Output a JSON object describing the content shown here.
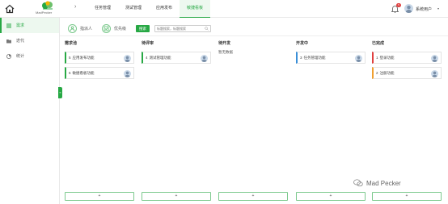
{
  "header": {
    "logo_text": "MadPecker",
    "nav": [
      "任务管理",
      "测试管理",
      "应用发布",
      "敏捷看板"
    ],
    "active_nav": 3,
    "notification_count": "5",
    "user_name": "系统用户"
  },
  "sidebar": {
    "items": [
      {
        "label": "需求",
        "icon": "list-icon"
      },
      {
        "label": "迭代",
        "icon": "folder-icon"
      },
      {
        "label": "统计",
        "icon": "chart-icon"
      }
    ],
    "active_index": 0,
    "toggle_label": "«"
  },
  "toolbar": {
    "assignee_label": "指派人",
    "priority_label": "优先级",
    "search_button": "搜索",
    "search_placeholder": "标题搜索，标题搜索"
  },
  "board": {
    "columns": [
      {
        "title": "需求池",
        "cards": [
          {
            "number": "5",
            "title": "应用发布功能",
            "accent": "#27a844"
          },
          {
            "number": "6",
            "title": "敏捷看板功能",
            "accent": "#27a844"
          }
        ],
        "empty_text": "",
        "add_label": "+"
      },
      {
        "title": "待评审",
        "cards": [
          {
            "number": "4",
            "title": "测试管理功能",
            "accent": "#27a844"
          }
        ],
        "empty_text": "",
        "add_label": "+"
      },
      {
        "title": "待开发",
        "cards": [],
        "empty_text": "暂无数据",
        "add_label": "+"
      },
      {
        "title": "开发中",
        "cards": [
          {
            "number": "3",
            "title": "任务管理功能",
            "accent": "#3a8fd8"
          }
        ],
        "empty_text": "",
        "add_label": "+"
      },
      {
        "title": "已完成",
        "cards": [
          {
            "number": "1",
            "title": "登录功能",
            "accent": "#e04040"
          },
          {
            "number": "2",
            "title": "注册功能",
            "accent": "#f0a030"
          }
        ],
        "empty_text": "",
        "add_label": "+"
      }
    ]
  },
  "watermark": {
    "text": "Mad Pecker"
  },
  "colors": {
    "brand": "#27a844",
    "active_bg": "#edf8ef"
  }
}
